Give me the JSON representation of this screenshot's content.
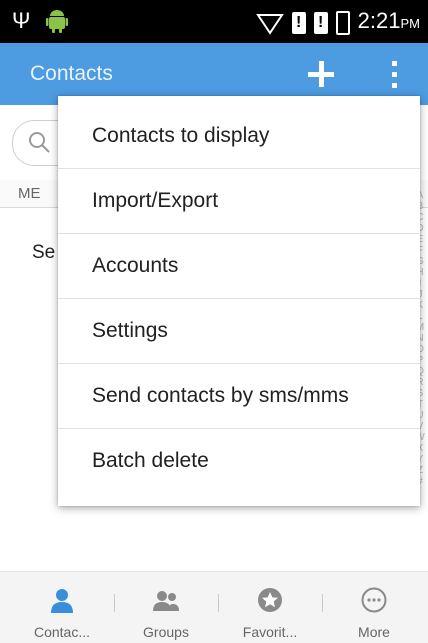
{
  "status_bar": {
    "time": "2:21",
    "ampm": "PM"
  },
  "action_bar": {
    "title": "Contacts"
  },
  "contacts": {
    "section_label": "ME",
    "partial_text": "Se"
  },
  "alpha_index": [
    "A",
    "B",
    "C",
    "D",
    "E",
    "F",
    "G",
    "H",
    "I",
    "J",
    "K",
    "L",
    "M",
    "N",
    "O",
    "P",
    "Q",
    "R",
    "S",
    "T",
    "U",
    "V",
    "W",
    "X",
    "Y",
    "Z",
    "#"
  ],
  "overflow_menu": {
    "items": [
      {
        "label": "Contacts to display"
      },
      {
        "label": "Import/Export"
      },
      {
        "label": "Accounts"
      },
      {
        "label": "Settings"
      },
      {
        "label": "Send contacts by sms/mms"
      },
      {
        "label": "Batch delete"
      }
    ]
  },
  "bottom_nav": {
    "tabs": [
      {
        "label": "Contac...",
        "icon": "person-icon",
        "active": true
      },
      {
        "label": "Groups",
        "icon": "group-icon",
        "active": false
      },
      {
        "label": "Favorit...",
        "icon": "star-icon",
        "active": false
      },
      {
        "label": "More",
        "icon": "more-icon",
        "active": false
      }
    ]
  },
  "colors": {
    "action_bar": "#4d9be0",
    "accent": "#3a8fdc"
  }
}
